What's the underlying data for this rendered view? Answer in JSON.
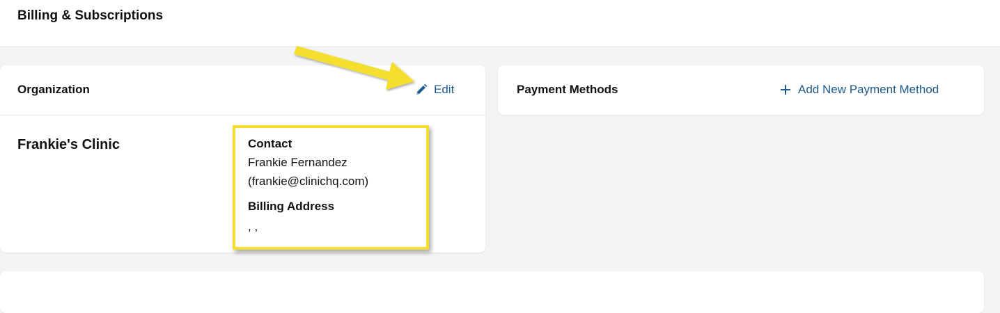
{
  "header": {
    "title": "Billing & Subscriptions"
  },
  "organization_card": {
    "title": "Organization",
    "edit_label": "Edit",
    "org_name": "Frankie's Clinic",
    "contact_label": "Contact",
    "contact_name": "Frankie Fernandez",
    "contact_email": "(frankie@clinichq.com)",
    "billing_address_label": "Billing Address",
    "billing_address_value": ", ,"
  },
  "payment_card": {
    "title": "Payment Methods",
    "add_label": "Add New Payment Method"
  },
  "colors": {
    "link": "#1e5a8a",
    "highlight": "#f5de2e",
    "background": "#f3f4f6"
  },
  "icons": {
    "edit": "pencil-icon",
    "add": "plus-icon",
    "annotation": "arrow-annotation"
  }
}
